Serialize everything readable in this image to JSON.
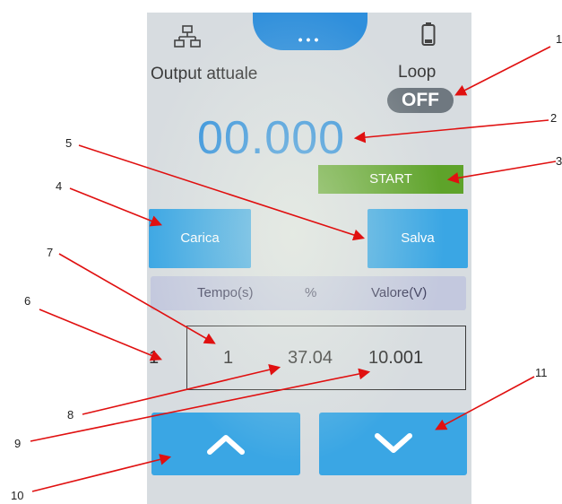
{
  "status_bar": {
    "network_icon": "network-icon",
    "battery_icon": "battery-icon",
    "tab_dots": "•••"
  },
  "header": {
    "output_label": "Output attuale",
    "loop_label": "Loop",
    "loop_state": "OFF"
  },
  "output_value": "00.000",
  "buttons": {
    "start": "START",
    "carica": "Carica",
    "salva": "Salva"
  },
  "table": {
    "headers": [
      "Tempo(s)",
      "%",
      "Valore(V)"
    ],
    "row_index": "1",
    "row": [
      "1",
      "37.04",
      "10.001"
    ]
  },
  "nav": {
    "up_icon": "chevron-up-icon",
    "down_icon": "chevron-down-icon"
  },
  "callouts": [
    "1",
    "2",
    "3",
    "4",
    "5",
    "6",
    "7",
    "8",
    "9",
    "10",
    "11"
  ],
  "colors": {
    "accent_blue": "#2f8fdc",
    "button_blue": "#3aa6e4",
    "start_green": "#5ea32a",
    "callout_red": "#e01010"
  }
}
